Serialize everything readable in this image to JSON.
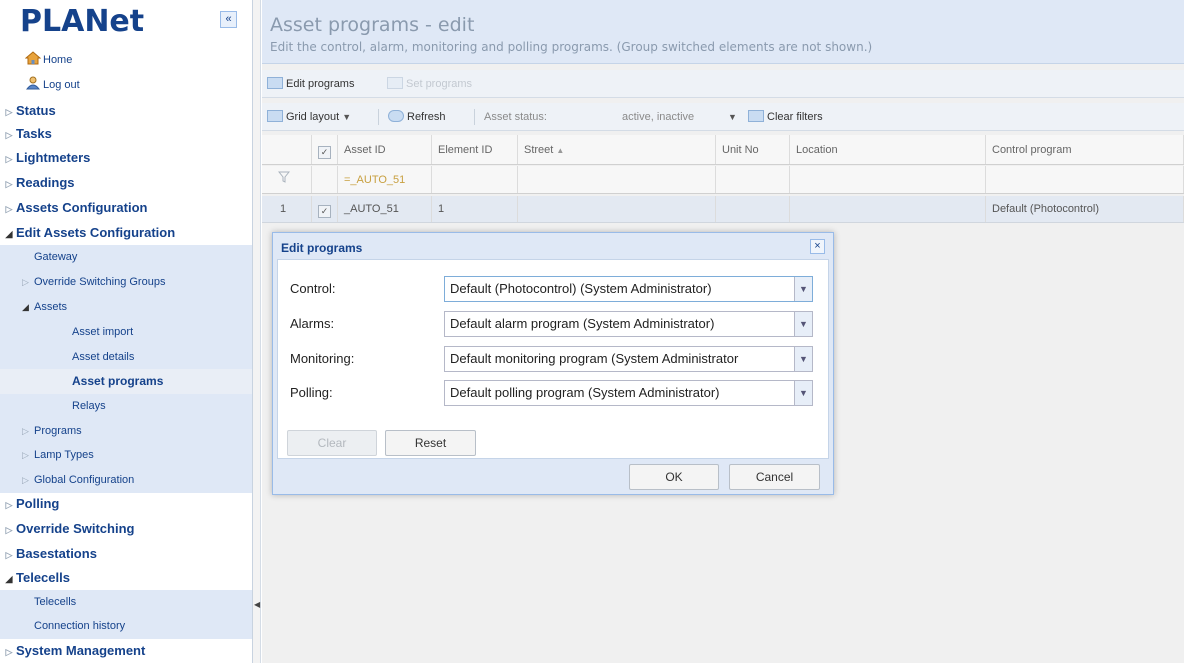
{
  "sidebar": {
    "logo": "PLANet",
    "collapse": "«",
    "home": "Home",
    "logout": "Log out",
    "nav": {
      "status": "Status",
      "tasks": "Tasks",
      "lightmeters": "Lightmeters",
      "readings": "Readings",
      "assets_configuration": "Assets Configuration",
      "edit_assets_configuration": "Edit Assets Configuration",
      "polling": "Polling",
      "override_switching": "Override Switching",
      "basestations": "Basestations",
      "telecells": "Telecells",
      "system_management": "System Management"
    },
    "sub": {
      "gateway": "Gateway",
      "override_switching_groups": "Override Switching Groups",
      "assets": "Assets",
      "asset_import": "Asset import",
      "asset_details": "Asset details",
      "asset_programs": "Asset programs",
      "relays": "Relays",
      "programs": "Programs",
      "lamp_types": "Lamp Types",
      "global_configuration": "Global Configuration",
      "telecells": "Telecells",
      "connection_history": "Connection history"
    }
  },
  "header": {
    "title": "Asset programs - edit",
    "subtitle": "Edit the control, alarm, monitoring and polling programs. (Group switched elements are not shown.)"
  },
  "toolbar1": {
    "edit_programs": "Edit programs",
    "set_programs": "Set programs"
  },
  "toolbar2": {
    "grid_layout": "Grid layout",
    "refresh": "Refresh",
    "asset_status_label": "Asset status:",
    "asset_status_value": "active, inactive",
    "clear_filters": "Clear filters"
  },
  "grid": {
    "columns": [
      "Asset ID",
      "Element ID",
      "Street",
      "Unit No",
      "Location",
      "Control program"
    ],
    "filter_asset_id": "=_AUTO_51",
    "rows": [
      {
        "num": "1",
        "asset_id": "_AUTO_51",
        "element_id": "1",
        "street": "",
        "unit_no": "",
        "location": "",
        "control_program": "Default (Photocontrol)"
      }
    ]
  },
  "dialog": {
    "title": "Edit programs",
    "close": "×",
    "fields": {
      "control_label": "Control:",
      "control_value": "Default (Photocontrol) (System Administrator)",
      "alarms_label": "Alarms:",
      "alarms_value": "Default alarm program (System Administrator)",
      "monitoring_label": "Monitoring:",
      "monitoring_value": "Default monitoring program (System Administrator",
      "polling_label": "Polling:",
      "polling_value": "Default polling program (System Administrator)"
    },
    "clear": "Clear",
    "reset": "Reset",
    "ok": "OK",
    "cancel": "Cancel"
  },
  "colors": {
    "brand": "#15428b",
    "panel_bg": "#dfe8f6",
    "border": "#99bbe8"
  }
}
